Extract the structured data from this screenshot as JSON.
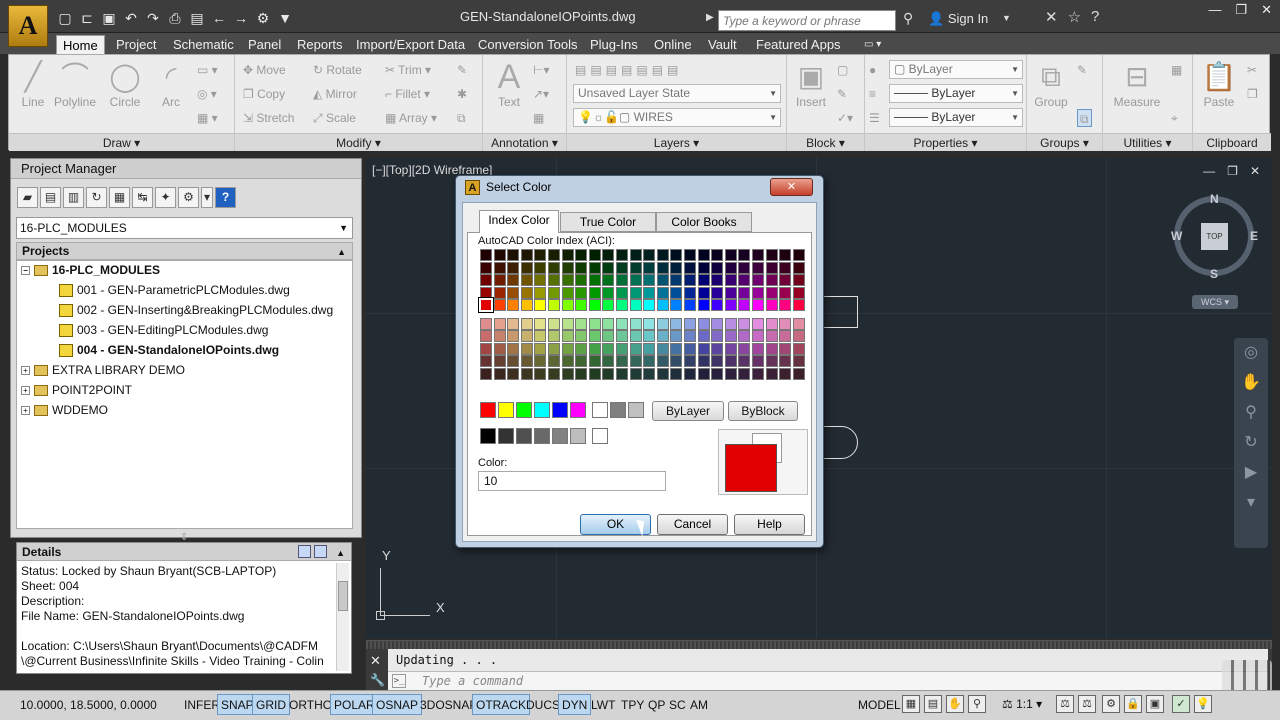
{
  "titlebar": {
    "logo": "A",
    "doc_title": "GEN-StandaloneIOPoints.dwg",
    "search_placeholder": "Type a keyword or phrase",
    "sign_in": "Sign In"
  },
  "tabs": [
    "Home",
    "Project",
    "Schematic",
    "Panel",
    "Reports",
    "Import/Export Data",
    "Conversion Tools",
    "Plug-Ins",
    "Online",
    "Vault",
    "Featured Apps"
  ],
  "ribbon": {
    "draw": {
      "label": "Draw",
      "tools": [
        "Line",
        "Polyline",
        "Circle",
        "Arc"
      ]
    },
    "modify": {
      "label": "Modify",
      "tools": [
        "Move",
        "Rotate",
        "Trim",
        "Copy",
        "Mirror",
        "Fillet",
        "Stretch",
        "Scale",
        "Array"
      ]
    },
    "annotation": {
      "label": "Annotation",
      "text": "Text"
    },
    "layers": {
      "label": "Layers",
      "state": "Unsaved Layer State",
      "layer": "WIRES"
    },
    "block": {
      "label": "Block",
      "insert": "Insert"
    },
    "properties": {
      "label": "Properties",
      "color": "ByLayer",
      "linetype": "ByLayer",
      "lineweight": "ByLayer"
    },
    "groups": {
      "label": "Groups",
      "group": "Group"
    },
    "utilities": {
      "label": "Utilities",
      "measure": "Measure"
    },
    "clipboard": {
      "label": "Clipboard",
      "paste": "Paste"
    }
  },
  "project_manager": {
    "title": "Project Manager",
    "selected_project": "16-PLC_MODULES",
    "projects_header": "Projects",
    "tree": [
      {
        "label": "16-PLC_MODULES",
        "kind": "project",
        "bold": true
      },
      {
        "label": "001 - GEN-ParametricPLCModules.dwg",
        "kind": "drawing"
      },
      {
        "label": "002 - GEN-Inserting&BreakingPLCModules.dwg",
        "kind": "drawing"
      },
      {
        "label": "003 - GEN-EditingPLCModules.dwg",
        "kind": "drawing"
      },
      {
        "label": "004 - GEN-StandaloneIOPoints.dwg",
        "kind": "drawing",
        "bold": true
      },
      {
        "label": "EXTRA LIBRARY DEMO",
        "kind": "project"
      },
      {
        "label": "POINT2POINT",
        "kind": "project"
      },
      {
        "label": "WDDEMO",
        "kind": "project"
      }
    ]
  },
  "details": {
    "header": "Details",
    "lines": [
      "Status: Locked by Shaun Bryant(SCB-LAPTOP)",
      "Sheet: 004",
      "Description:",
      "File Name: GEN-StandaloneIOPoints.dwg",
      "",
      "Location: C:\\Users\\Shaun Bryant\\Documents\\@CADFM",
      "\\@Current Business\\Infinite Skills - Video Training - Colin"
    ]
  },
  "viewport": {
    "label": "[−][Top][2D Wireframe]",
    "top": "TOP",
    "n": "N",
    "s": "S",
    "e": "E",
    "w": "W",
    "wcs": "WCS",
    "ucs_x": "X",
    "ucs_y": "Y"
  },
  "command": {
    "history": "Updating . . .",
    "placeholder": "Type a command"
  },
  "status": {
    "coords": "10.0000, 18.5000, 0.0000",
    "buttons": [
      {
        "label": "INFER",
        "on": false
      },
      {
        "label": "SNAP",
        "on": true
      },
      {
        "label": "GRID",
        "on": true
      },
      {
        "label": "ORTHO",
        "on": false
      },
      {
        "label": "POLAR",
        "on": true
      },
      {
        "label": "OSNAP",
        "on": true
      },
      {
        "label": "3DOSNAP",
        "on": false
      },
      {
        "label": "OTRACK",
        "on": true
      },
      {
        "label": "DUCS",
        "on": false
      },
      {
        "label": "DYN",
        "on": true
      },
      {
        "label": "LWT",
        "on": false
      },
      {
        "label": "TPY",
        "on": false
      },
      {
        "label": "QP",
        "on": false
      },
      {
        "label": "SC",
        "on": false
      },
      {
        "label": "AM",
        "on": false
      }
    ],
    "model": "MODEL",
    "scale": "1:1"
  },
  "dialog": {
    "title": "Select Color",
    "tabs": [
      "Index Color",
      "True Color",
      "Color Books"
    ],
    "aci_label": "AutoCAD Color Index (ACI):",
    "bylayer": "ByLayer",
    "byblock": "ByBlock",
    "color_label": "Color:",
    "color_value": "10",
    "current_color": "#e00000",
    "buttons": {
      "ok": "OK",
      "cancel": "Cancel",
      "help": "Help"
    },
    "selected_index": 10
  }
}
